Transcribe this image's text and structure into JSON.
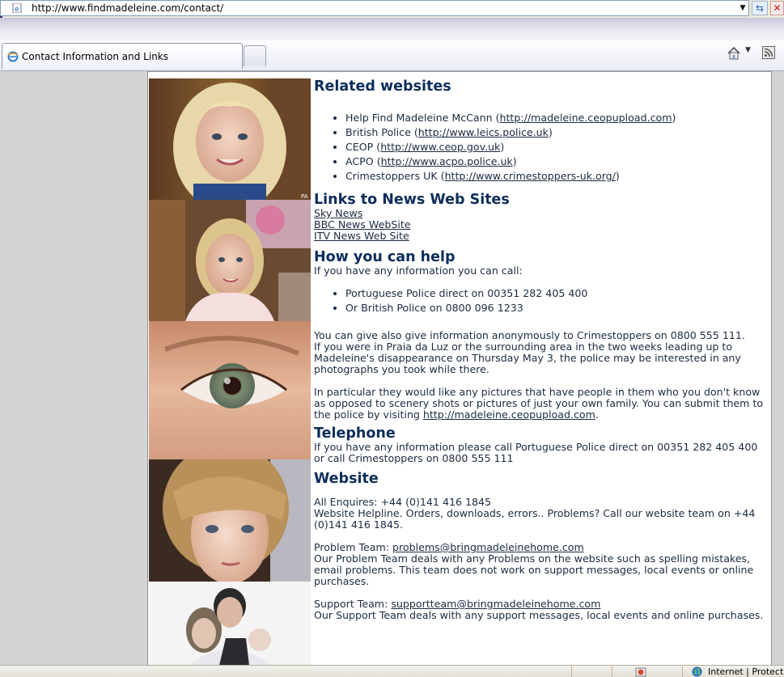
{
  "browser": {
    "address_url": "http://www.findmadeleine.com/contact/",
    "tab_title": "Contact Information and Links",
    "status_zone": "Internet | Protecte"
  },
  "sections": {
    "related": {
      "heading": "Related websites",
      "items": [
        {
          "prefix": "Help Find Madeleine McCann (",
          "link": "http://madeleine.ceopupload.com",
          "suffix": ")"
        },
        {
          "prefix": "British Police (",
          "link": "http://www.leics.police.uk",
          "suffix": ")"
        },
        {
          "prefix": "CEOP (",
          "link": "http://www.ceop.gov.uk",
          "suffix": ")"
        },
        {
          "prefix": "ACPO (",
          "link": "http://www.acpo.police.uk",
          "suffix": ")"
        },
        {
          "prefix": "Crimestoppers UK (",
          "link": "http://www.crimestoppers-uk.org/",
          "suffix": ")"
        }
      ]
    },
    "news": {
      "heading": "Links to News Web Sites",
      "links": [
        "Sky News",
        "BBC News WebSite",
        "ITV News Web Site"
      ]
    },
    "help": {
      "heading": "How you can help",
      "intro": "If you have any information you can call:",
      "items": [
        "Portuguese Police direct on 00351 282 405 400",
        "Or British Police on 0800 096 1233"
      ],
      "para1": "You can give also give information anonymously to Crimestoppers on 0800 555 111.",
      "para2": "If you were in Praia da Luz or the surrounding area in the two weeks leading up to Madeleine's disappearance on Thursday May 3, the police may be interested in any photographs you took while there.",
      "para3_text": "In particular they would like any pictures that have people in them who you don't know as opposed to scenery shots or pictures of just your own family. You can submit them to the police by visiting ",
      "para3_link": "http://madeleine.ceopupload.com",
      "para3_end": "."
    },
    "telephone": {
      "heading": "Telephone",
      "text": "If you have any information please call Portuguese Police direct on 00351 282 405 400 or call Crimestoppers on 0800 555 111"
    },
    "website": {
      "heading": "Website",
      "enquiries": "All Enquires: +44 (0)141 416 1845",
      "helpline": "Website Helpline. Orders, downloads, errors.. Problems? Call our website team on +44 (0)141 416 1845.",
      "problem_label": "Problem Team: ",
      "problem_email": "problems@bringmadeleinehome.com",
      "problem_text": "Our Problem Team deals with any Problems on the website such as spelling mistakes, email problems. This team does not work on support messages, local events or online purchases.",
      "support_label": "Support Team: ",
      "support_email": "supportteam@bringmadeleinehome.com",
      "support_text": "Our Support Team deals with any support messages, local events and online purchases."
    }
  },
  "photo_credit": "PA",
  "icons": [
    "ie-page-icon",
    "dropdown-arrow-icon",
    "refresh-icon",
    "stop-icon",
    "home-icon",
    "feed-icon",
    "globe-icon",
    "security-icon"
  ]
}
